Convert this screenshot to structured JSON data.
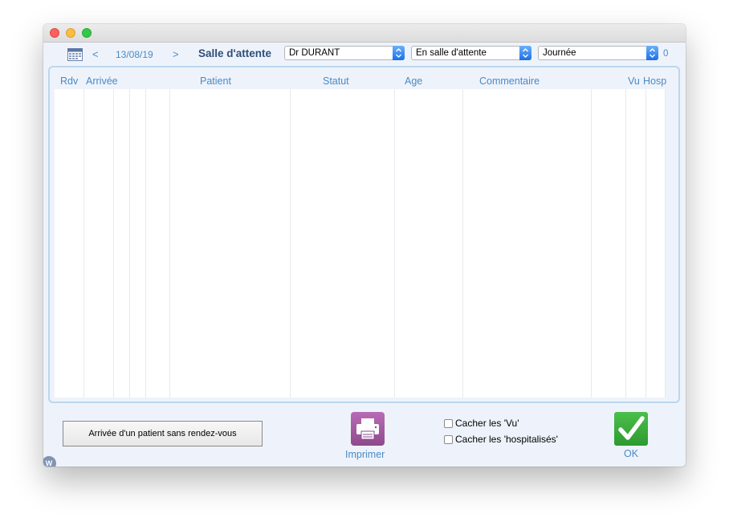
{
  "toolbar": {
    "prev_label": "<",
    "date": "13/08/19",
    "next_label": ">",
    "title": "Salle d'attente",
    "doctor_select": "Dr DURANT",
    "status_select": "En salle d'attente",
    "period_select": "Journée",
    "count": "0"
  },
  "table": {
    "headers": [
      "Rdv",
      "Arrivée",
      "Patient",
      "Statut",
      "Age",
      "Commentaire",
      "Vu",
      "Hosp"
    ],
    "rows": []
  },
  "footer": {
    "arrivee_button": "Arrivée d'un patient sans rendez-vous",
    "print_label": "Imprimer",
    "checkbox_vu": "Cacher les 'Vu'",
    "checkbox_hosp": "Cacher les 'hospitalisés'",
    "ok_label": "OK",
    "logo_letter": "W"
  },
  "colors": {
    "accent": "#4a8ac4",
    "title": "#2f4e7a",
    "print_button": "#a65aa2",
    "ok_button": "#3aaa3c"
  },
  "icons": [
    "calendar-icon",
    "printer-icon",
    "checkmark-icon",
    "select-arrows-icon"
  ]
}
